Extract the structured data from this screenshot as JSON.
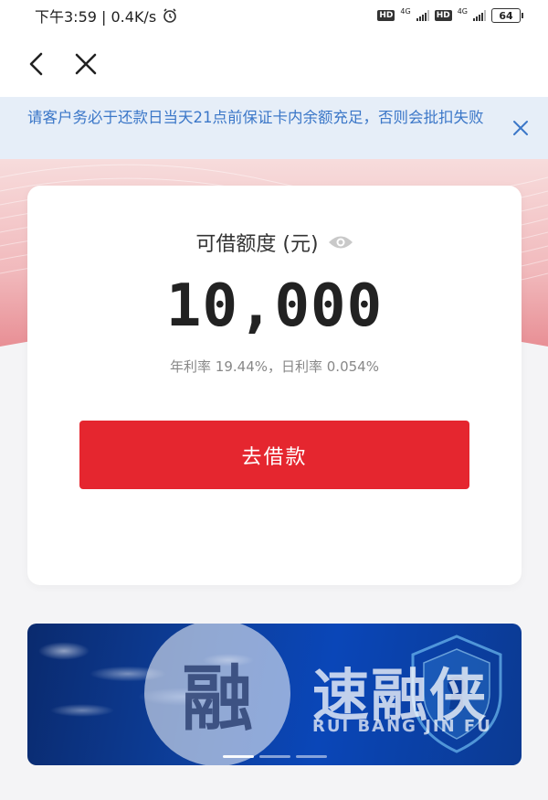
{
  "status_bar": {
    "time_speed": "下午3:59 | 0.4K/s",
    "hd1": "HD",
    "net1": "4G",
    "hd2": "HD",
    "net2": "4G",
    "battery": "64"
  },
  "notice": {
    "text": "请客户务必于还款日当天21点前保证卡内余额充足，否则会批扣失败"
  },
  "credit": {
    "label": "可借额度 (元)",
    "amount": "10,000",
    "rates": "年利率 19.44%，日利率 0.054%"
  },
  "actions": {
    "borrow_label": "去借款"
  },
  "banner": {
    "watermark_char": "融",
    "watermark_name": "速融侠",
    "watermark_pinyin": "RUI BANG JIN FU"
  },
  "colors": {
    "accent_red": "#e5262f",
    "notice_text": "#3b77c8",
    "notice_bg": "#e6eef8"
  }
}
